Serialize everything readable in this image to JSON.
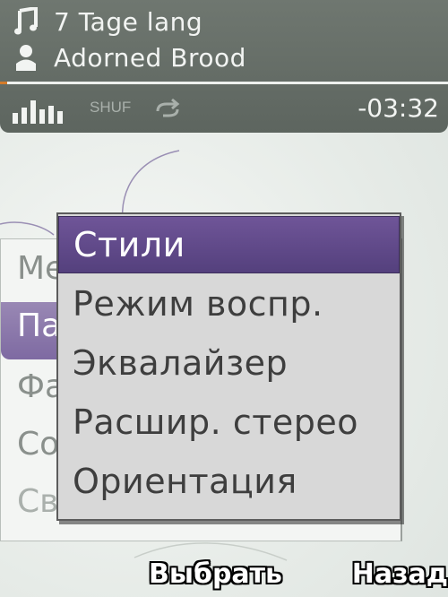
{
  "now_playing": {
    "track_title": "7 Tage lang",
    "artist": "Adorned Brood",
    "shuffle_label": "SHUF",
    "time_remaining": "-03:32",
    "icons": {
      "track": "music-note-icon",
      "artist": "person-icon",
      "signal": "signal-bars-icon",
      "repeat": "repeat-icon"
    },
    "accent_color": "#d47b2a"
  },
  "background_list": {
    "items": [
      "Ме",
      "Па",
      "Фа",
      "Со",
      "Св"
    ],
    "highlighted_index": 1,
    "highlight_color": "#8c78ad"
  },
  "options_menu": {
    "items": [
      {
        "label": "Стили",
        "selected": true
      },
      {
        "label": "Режим воспр.",
        "selected": false
      },
      {
        "label": "Эквалайзер",
        "selected": false
      },
      {
        "label": "Расшир. стерео",
        "selected": false
      },
      {
        "label": "Ориентация",
        "selected": false
      }
    ],
    "selection_color": "#5e4788"
  },
  "softkeys": {
    "left": "Выбрать",
    "right": "Назад"
  }
}
